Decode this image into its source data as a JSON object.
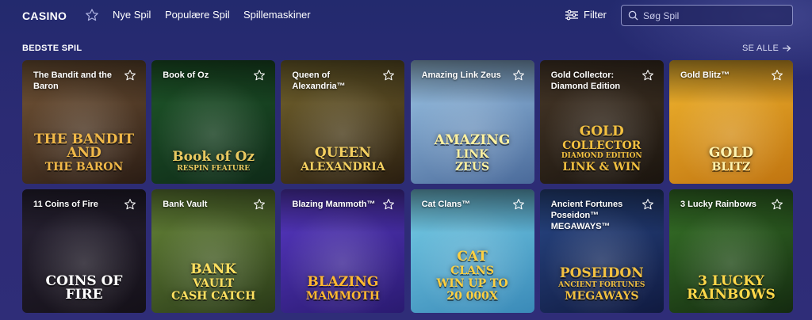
{
  "header": {
    "brand": "CASINO",
    "nav": [
      "Nye Spil",
      "Populære Spil",
      "Spillemaskiner"
    ],
    "filter_label": "Filter",
    "search_placeholder": "Søg Spil"
  },
  "section": {
    "title": "BEDSTE SPIL",
    "see_all": "SE ALLE"
  },
  "games": [
    {
      "name": "The Bandit and the Baron",
      "logo_lines": [
        "THE BANDIT AND",
        "THE BARON"
      ],
      "bg": [
        "#7a5a3a",
        "#2a1c14"
      ],
      "logo_color": "#f0b848"
    },
    {
      "name": "Book of Oz",
      "logo_lines": [
        "Book of Oz",
        "RESPIN FEATURE"
      ],
      "bg": [
        "#1f5a2a",
        "#0f2a18"
      ],
      "logo_color": "#e8c860"
    },
    {
      "name": "Queen of Alexandria™",
      "logo_lines": [
        "QUEEN",
        "ALEXANDRIA"
      ],
      "bg": [
        "#7a6a30",
        "#2a1e10"
      ],
      "logo_color": "#f4d060"
    },
    {
      "name": "Amazing Link Zeus",
      "logo_lines": [
        "AMAZING",
        "LINK",
        "ZEUS"
      ],
      "bg": [
        "#9fc8e8",
        "#4a6a9a"
      ],
      "logo_color": "#fff2a0"
    },
    {
      "name": "Gold Collector: Diamond Edition",
      "logo_lines": [
        "GOLD",
        "COLLECTOR",
        "DIAMOND EDITION",
        "LINK & WIN"
      ],
      "bg": [
        "#4a3a2a",
        "#1a140e"
      ],
      "logo_color": "#f2c040"
    },
    {
      "name": "Gold Blitz™",
      "logo_lines": [
        "GOLD",
        "BLITZ"
      ],
      "bg": [
        "#f2b830",
        "#c07410"
      ],
      "logo_color": "#fff4b0"
    },
    {
      "name": "11 Coins of Fire",
      "logo_lines": [
        "COINS OF FIRE"
      ],
      "bg": [
        "#2a2436",
        "#141018"
      ],
      "logo_color": "#ffffff"
    },
    {
      "name": "Bank Vault",
      "logo_lines": [
        "BANK",
        "VAULT",
        "CASH CATCH"
      ],
      "bg": [
        "#6a8a3a",
        "#2a3a18"
      ],
      "logo_color": "#ffe060"
    },
    {
      "name": "Blazing Mammoth™",
      "logo_lines": [
        "BLAZING",
        "MAMMOTH"
      ],
      "bg": [
        "#5a3ac8",
        "#2a1a70"
      ],
      "logo_color": "#ffb830"
    },
    {
      "name": "Cat Clans™",
      "logo_lines": [
        "CAT",
        "CLANS",
        "WIN UP TO",
        "20 000X"
      ],
      "bg": [
        "#7ad0e8",
        "#3a8ab8"
      ],
      "logo_color": "#ffd040"
    },
    {
      "name": "Ancient Fortunes Poseidon™ MEGAWAYS™",
      "logo_lines": [
        "POSEIDON",
        "ANCIENT FORTUNES",
        "MEGAWAYS"
      ],
      "bg": [
        "#2a4a8a",
        "#101a40"
      ],
      "logo_color": "#f2c040"
    },
    {
      "name": "3 Lucky Rainbows",
      "logo_lines": [
        "3 LUCKY RAINBOWS"
      ],
      "bg": [
        "#3a7a2a",
        "#142a10"
      ],
      "logo_color": "#ffd84a"
    }
  ]
}
